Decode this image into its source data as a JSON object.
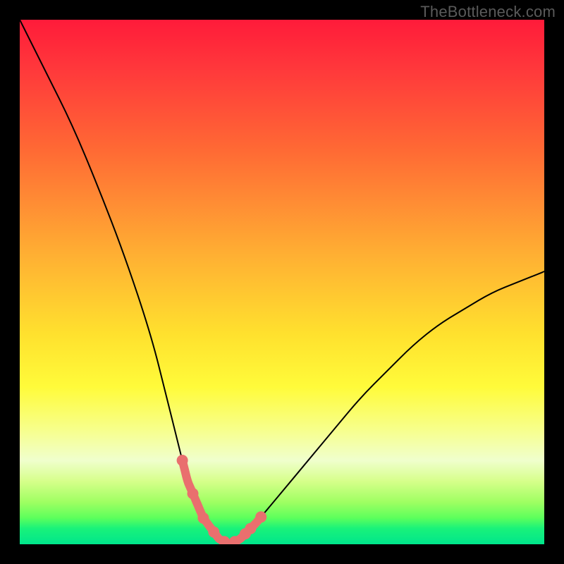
{
  "watermark": "TheBottleneck.com",
  "colors": {
    "background": "#000000",
    "curve": "#000000",
    "accent": "#e96f6e"
  },
  "chart_data": {
    "type": "line",
    "title": "",
    "xlabel": "",
    "ylabel": "",
    "xlim": [
      0,
      100
    ],
    "ylim": [
      0,
      100
    ],
    "grid": false,
    "legend": false,
    "note": "Axes are unlabeled; values below are normalized estimates (0–100) read from the image. y=0 is the bottom (minimum), y=100 is the top.",
    "series": [
      {
        "name": "bottleneck-curve",
        "x": [
          0,
          5,
          10,
          15,
          20,
          25,
          28,
          30,
          32,
          35,
          38,
          40,
          42,
          45,
          50,
          55,
          60,
          65,
          70,
          75,
          80,
          85,
          90,
          95,
          100
        ],
        "y": [
          100,
          90,
          80,
          68,
          55,
          40,
          28,
          20,
          12,
          5,
          1,
          0,
          1,
          4,
          10,
          16,
          22,
          28,
          33,
          38,
          42,
          45,
          48,
          50,
          52
        ]
      }
    ],
    "accent_region": {
      "description": "Highlighted segment around the curve minimum",
      "x_start": 31,
      "x_end": 46,
      "dots_x": [
        31,
        33,
        35,
        37,
        39,
        41,
        43,
        44,
        46
      ]
    }
  }
}
